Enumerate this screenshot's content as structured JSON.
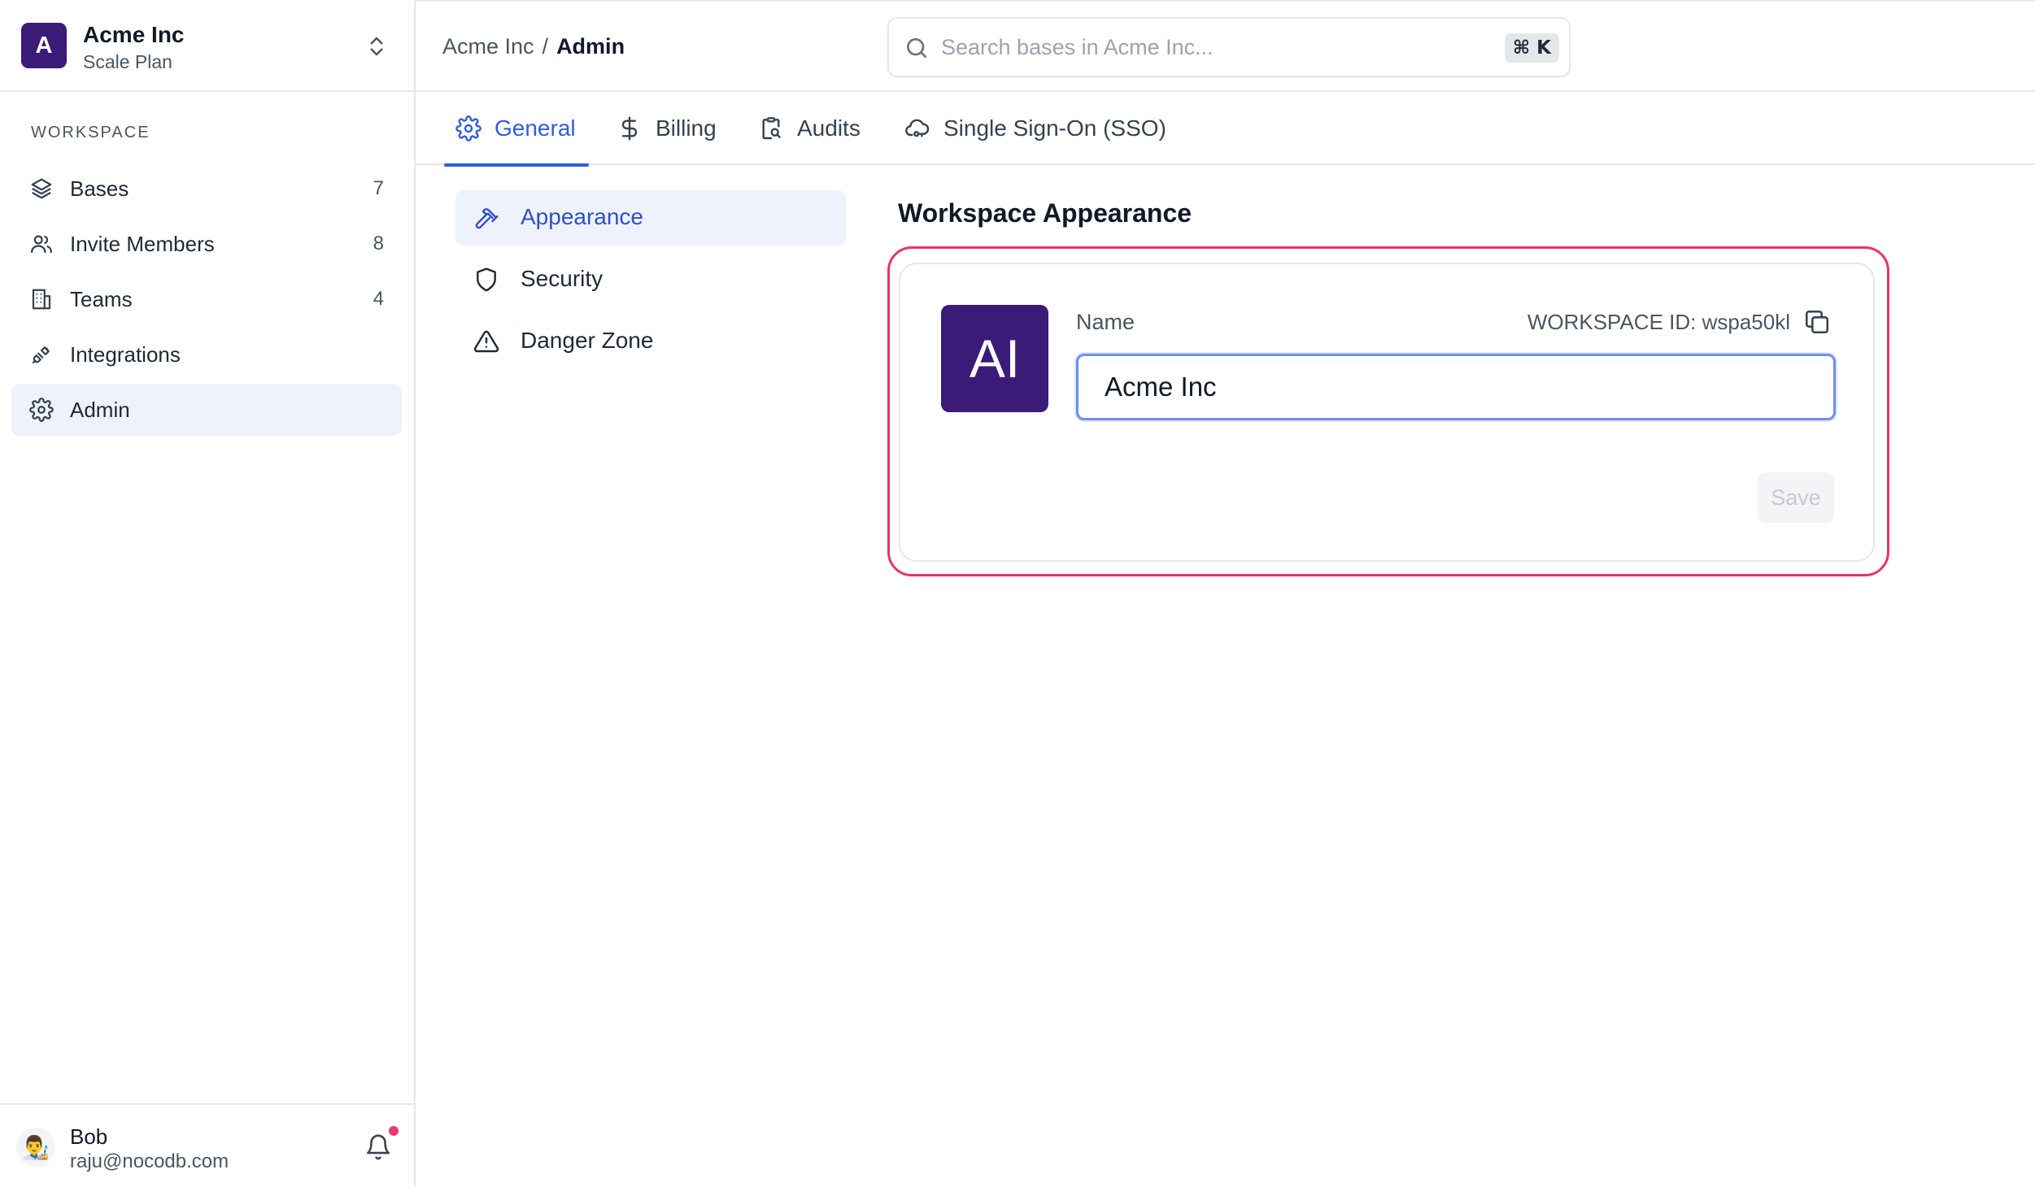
{
  "workspace": {
    "avatar_letter": "A",
    "name": "Acme Inc",
    "plan": "Scale Plan"
  },
  "sidebar": {
    "section_label": "WORKSPACE",
    "items": [
      {
        "label": "Bases",
        "count": "7",
        "icon": "layers-icon"
      },
      {
        "label": "Invite Members",
        "count": "8",
        "icon": "users-icon"
      },
      {
        "label": "Teams",
        "count": "4",
        "icon": "building-icon"
      },
      {
        "label": "Integrations",
        "count": "",
        "icon": "plug-icon"
      },
      {
        "label": "Admin",
        "count": "",
        "icon": "gear-icon",
        "active": true
      }
    ]
  },
  "user": {
    "avatar_emoji": "👨‍🎨",
    "name": "Bob",
    "email": "raju@nocodb.com",
    "has_notification": true
  },
  "breadcrumb": {
    "parent": "Acme Inc",
    "separator": "/",
    "current": "Admin"
  },
  "search": {
    "placeholder": "Search bases in Acme Inc...",
    "shortcut": "⌘ K"
  },
  "tabs": [
    {
      "label": "General",
      "icon": "gear-icon",
      "active": true
    },
    {
      "label": "Billing",
      "icon": "dollar-icon"
    },
    {
      "label": "Audits",
      "icon": "clipboard-search-icon"
    },
    {
      "label": "Single Sign-On (SSO)",
      "icon": "cloud-key-icon"
    }
  ],
  "submenu": [
    {
      "label": "Appearance",
      "icon": "hammer-icon",
      "active": true
    },
    {
      "label": "Security",
      "icon": "shield-icon"
    },
    {
      "label": "Danger Zone",
      "icon": "warning-icon"
    }
  ],
  "appearance": {
    "title": "Workspace Appearance",
    "avatar_initials": "AI",
    "name_label": "Name",
    "workspace_id_label": "WORKSPACE ID: wspa50kl",
    "name_value": "Acme Inc",
    "save_label": "Save"
  },
  "colors": {
    "accent": "#2f5ddc",
    "avatar_bg": "#3b1a78",
    "highlight_border": "#e8336a",
    "active_bg": "#eef2fc",
    "notification_dot": "#f0386b"
  }
}
